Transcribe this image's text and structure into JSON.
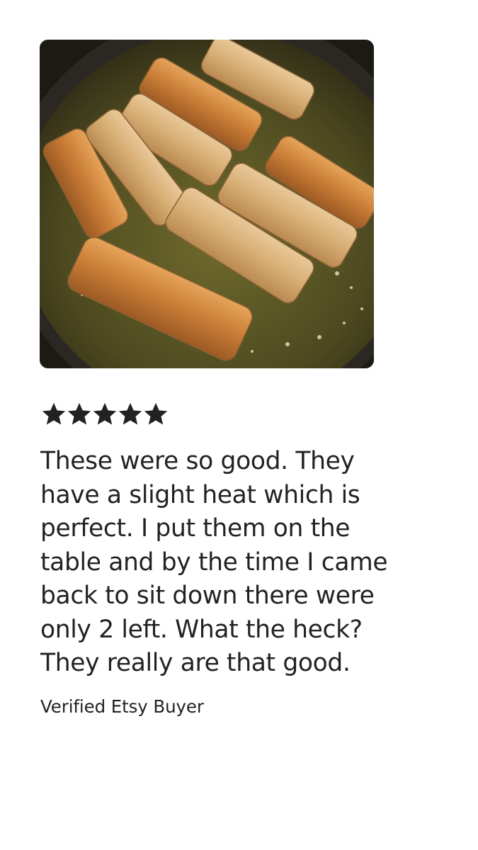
{
  "review": {
    "photo_subject": "egg-rolls-frying-in-pan",
    "rating": 5,
    "rating_max": 5,
    "star_icon": "star-icon",
    "star_color": "#222222",
    "text": "These were so good.  They\nhave a slight heat which is\nperfect.  I put them on the\ntable and by the time I came\nback to sit down there were\nonly 2 left.  What the heck?\nThey really are that good.",
    "author": "Verified Etsy Buyer"
  }
}
